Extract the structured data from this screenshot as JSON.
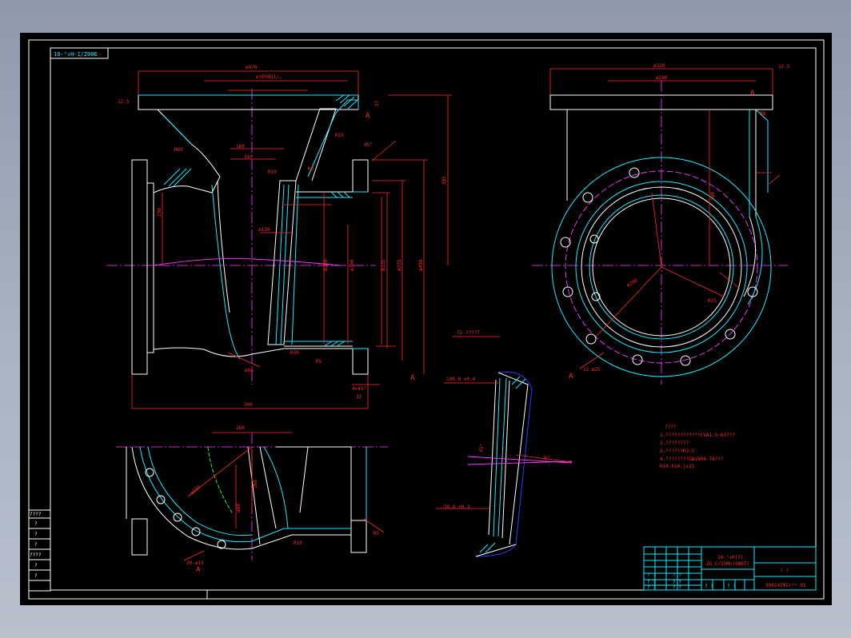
{
  "drawing": {
    "corner_code": "10-⁵₈H-1/Z00E",
    "dimensions": {
      "d470": "ø470",
      "d395": "ø395H11/…",
      "d320": "ø320",
      "d280": "ø280",
      "d490": "ø490",
      "d375": "ø375",
      "d335": "ø335",
      "d300": "ø300",
      "d200": "ø200",
      "d80": "ø80",
      "d40": "ø40",
      "d130": "ø130",
      "len300": "300",
      "len305": "305",
      "len290": "290",
      "len37": "37",
      "len32": "32",
      "len260": "260",
      "len180": "180",
      "len160": "160",
      "len110": "110",
      "holes_main": "12-ø25",
      "holes_bottom": "20-ø13",
      "chamfer": "4×45°",
      "ang45": "45°",
      "roughness": "12.5",
      "detail_a": "A",
      "r60": "R60",
      "r25": "R25",
      "r10": "R10",
      "r8": "R8",
      "r5": "R5",
      "r30": "R30",
      "detail_label": "72 ????7",
      "detail_value1": "100.8 ±0.4",
      "detail_value2": "50.6 ±0.3",
      "detail_angle": "8°"
    },
    "notes": {
      "title": "????",
      "lines": [
        "1.????????????CVA1.5~63???",
        "2.????????",
        "3.??????R3~5",
        "4.????????GB1804-79???",
        "  H14.h14.js15"
      ]
    },
    "title_block": {
      "left_rows": [
        "????",
        "?",
        "?",
        "?",
        "????",
        "?",
        "?"
      ],
      "part_name_line1": "10-⁵₈H(7)",
      "part_name_line2": "ZG Cr15Mn(5N6T)",
      "scale_marks": "? ?",
      "drawing_number": "300241YGr¹ᵅ-01",
      "small_cells": [
        "? ?",
        "? ?",
        "? ?",
        "? ?",
        "? ?",
        "? ?",
        "? ?",
        "? ?"
      ]
    }
  }
}
